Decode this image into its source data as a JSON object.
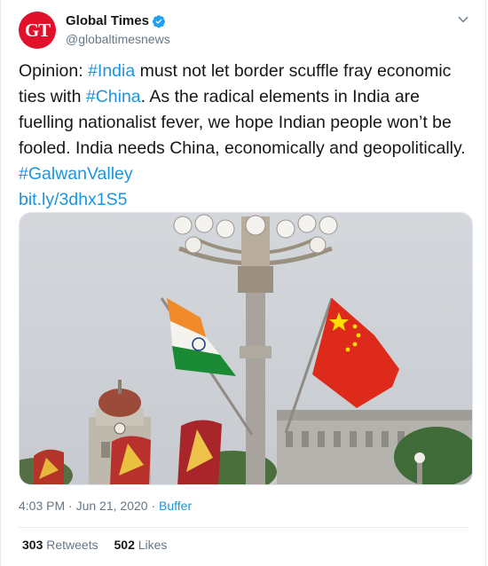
{
  "tweet": {
    "avatar_text": "GT",
    "display_name": "Global Times",
    "handle": "@globaltimesnews",
    "text_intro": "Opinion: ",
    "hashtag_india": "#India",
    "text_1": " must not let border scuffle fray economic ties with ",
    "hashtag_china": "#China",
    "text_2": ". As the radical elements in India are fuelling nationalist fever, we hope Indian people won’t be fooled. India needs China, economically and geopolitically. ",
    "hashtag_galwan": "#GalwanValley",
    "short_link": "bit.ly/3dhx1S5",
    "time": "4:03 PM",
    "separator": " · ",
    "date": "Jun 21, 2020",
    "source": "Buffer",
    "retweets_count": "303",
    "retweets_label": "Retweets",
    "likes_count": "502",
    "likes_label": "Likes"
  },
  "colors": {
    "link": "#1b95e0",
    "avatar_bg": "#e0112b",
    "muted": "#657786"
  },
  "icons": {
    "verified": "verified-badge-icon",
    "menu": "chevron-down-icon"
  }
}
